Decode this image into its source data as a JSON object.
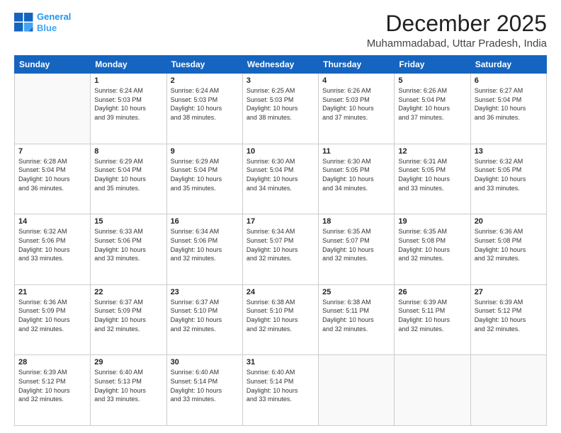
{
  "header": {
    "logo_line1": "General",
    "logo_line2": "Blue",
    "month": "December 2025",
    "location": "Muhammadabad, Uttar Pradesh, India"
  },
  "days_of_week": [
    "Sunday",
    "Monday",
    "Tuesday",
    "Wednesday",
    "Thursday",
    "Friday",
    "Saturday"
  ],
  "weeks": [
    [
      {
        "day": "",
        "info": ""
      },
      {
        "day": "1",
        "info": "Sunrise: 6:24 AM\nSunset: 5:03 PM\nDaylight: 10 hours\nand 39 minutes."
      },
      {
        "day": "2",
        "info": "Sunrise: 6:24 AM\nSunset: 5:03 PM\nDaylight: 10 hours\nand 38 minutes."
      },
      {
        "day": "3",
        "info": "Sunrise: 6:25 AM\nSunset: 5:03 PM\nDaylight: 10 hours\nand 38 minutes."
      },
      {
        "day": "4",
        "info": "Sunrise: 6:26 AM\nSunset: 5:03 PM\nDaylight: 10 hours\nand 37 minutes."
      },
      {
        "day": "5",
        "info": "Sunrise: 6:26 AM\nSunset: 5:04 PM\nDaylight: 10 hours\nand 37 minutes."
      },
      {
        "day": "6",
        "info": "Sunrise: 6:27 AM\nSunset: 5:04 PM\nDaylight: 10 hours\nand 36 minutes."
      }
    ],
    [
      {
        "day": "7",
        "info": "Sunrise: 6:28 AM\nSunset: 5:04 PM\nDaylight: 10 hours\nand 36 minutes."
      },
      {
        "day": "8",
        "info": "Sunrise: 6:29 AM\nSunset: 5:04 PM\nDaylight: 10 hours\nand 35 minutes."
      },
      {
        "day": "9",
        "info": "Sunrise: 6:29 AM\nSunset: 5:04 PM\nDaylight: 10 hours\nand 35 minutes."
      },
      {
        "day": "10",
        "info": "Sunrise: 6:30 AM\nSunset: 5:04 PM\nDaylight: 10 hours\nand 34 minutes."
      },
      {
        "day": "11",
        "info": "Sunrise: 6:30 AM\nSunset: 5:05 PM\nDaylight: 10 hours\nand 34 minutes."
      },
      {
        "day": "12",
        "info": "Sunrise: 6:31 AM\nSunset: 5:05 PM\nDaylight: 10 hours\nand 33 minutes."
      },
      {
        "day": "13",
        "info": "Sunrise: 6:32 AM\nSunset: 5:05 PM\nDaylight: 10 hours\nand 33 minutes."
      }
    ],
    [
      {
        "day": "14",
        "info": "Sunrise: 6:32 AM\nSunset: 5:06 PM\nDaylight: 10 hours\nand 33 minutes."
      },
      {
        "day": "15",
        "info": "Sunrise: 6:33 AM\nSunset: 5:06 PM\nDaylight: 10 hours\nand 33 minutes."
      },
      {
        "day": "16",
        "info": "Sunrise: 6:34 AM\nSunset: 5:06 PM\nDaylight: 10 hours\nand 32 minutes."
      },
      {
        "day": "17",
        "info": "Sunrise: 6:34 AM\nSunset: 5:07 PM\nDaylight: 10 hours\nand 32 minutes."
      },
      {
        "day": "18",
        "info": "Sunrise: 6:35 AM\nSunset: 5:07 PM\nDaylight: 10 hours\nand 32 minutes."
      },
      {
        "day": "19",
        "info": "Sunrise: 6:35 AM\nSunset: 5:08 PM\nDaylight: 10 hours\nand 32 minutes."
      },
      {
        "day": "20",
        "info": "Sunrise: 6:36 AM\nSunset: 5:08 PM\nDaylight: 10 hours\nand 32 minutes."
      }
    ],
    [
      {
        "day": "21",
        "info": "Sunrise: 6:36 AM\nSunset: 5:09 PM\nDaylight: 10 hours\nand 32 minutes."
      },
      {
        "day": "22",
        "info": "Sunrise: 6:37 AM\nSunset: 5:09 PM\nDaylight: 10 hours\nand 32 minutes."
      },
      {
        "day": "23",
        "info": "Sunrise: 6:37 AM\nSunset: 5:10 PM\nDaylight: 10 hours\nand 32 minutes."
      },
      {
        "day": "24",
        "info": "Sunrise: 6:38 AM\nSunset: 5:10 PM\nDaylight: 10 hours\nand 32 minutes."
      },
      {
        "day": "25",
        "info": "Sunrise: 6:38 AM\nSunset: 5:11 PM\nDaylight: 10 hours\nand 32 minutes."
      },
      {
        "day": "26",
        "info": "Sunrise: 6:39 AM\nSunset: 5:11 PM\nDaylight: 10 hours\nand 32 minutes."
      },
      {
        "day": "27",
        "info": "Sunrise: 6:39 AM\nSunset: 5:12 PM\nDaylight: 10 hours\nand 32 minutes."
      }
    ],
    [
      {
        "day": "28",
        "info": "Sunrise: 6:39 AM\nSunset: 5:12 PM\nDaylight: 10 hours\nand 32 minutes."
      },
      {
        "day": "29",
        "info": "Sunrise: 6:40 AM\nSunset: 5:13 PM\nDaylight: 10 hours\nand 33 minutes."
      },
      {
        "day": "30",
        "info": "Sunrise: 6:40 AM\nSunset: 5:14 PM\nDaylight: 10 hours\nand 33 minutes."
      },
      {
        "day": "31",
        "info": "Sunrise: 6:40 AM\nSunset: 5:14 PM\nDaylight: 10 hours\nand 33 minutes."
      },
      {
        "day": "",
        "info": ""
      },
      {
        "day": "",
        "info": ""
      },
      {
        "day": "",
        "info": ""
      }
    ]
  ]
}
